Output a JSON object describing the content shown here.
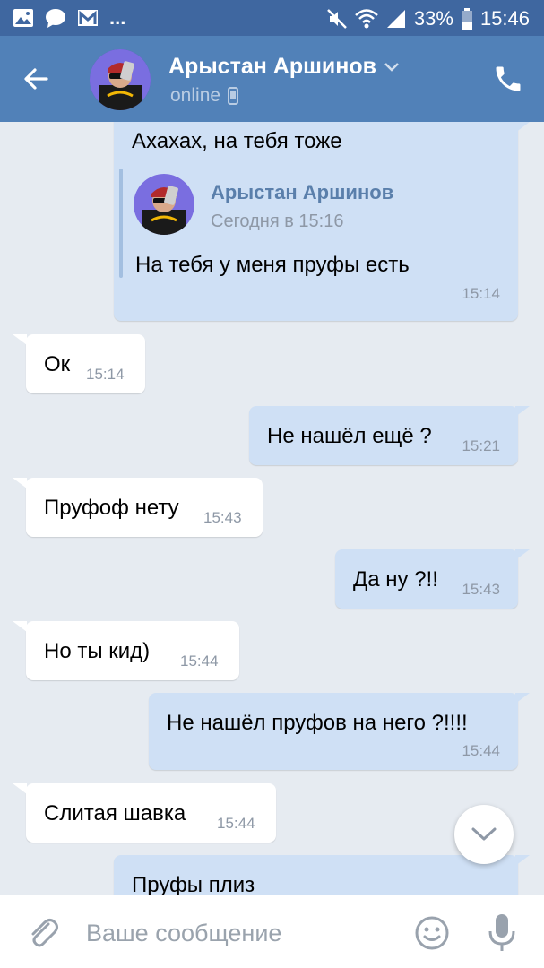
{
  "status_bar": {
    "battery": "33%",
    "time": "15:46",
    "left_icons": [
      "gallery-icon",
      "message-icon",
      "gmail-icon"
    ],
    "right_icons": [
      "mute-icon",
      "wifi-icon",
      "signal-icon",
      "battery-icon"
    ]
  },
  "header": {
    "contact_name": "Арыстан Аршинов",
    "status": "online",
    "status_device": "mobile-icon"
  },
  "messages": [
    {
      "direction": "out",
      "text": "Ахахах, на тебя тоже",
      "time": "15:14",
      "forwarded": {
        "author": "Арыстан Аршинов",
        "date": "Сегодня в 15:16",
        "text": "На тебя у меня пруфы есть"
      }
    },
    {
      "direction": "in",
      "text": "Ок",
      "time": "15:14"
    },
    {
      "direction": "out",
      "text": "Не нашёл ещё ?",
      "time": "15:21"
    },
    {
      "direction": "in",
      "text": "Пруфоф нету",
      "time": "15:43"
    },
    {
      "direction": "out",
      "text": "Да ну ?!!",
      "time": "15:43"
    },
    {
      "direction": "in",
      "text": "Но ты кид)",
      "time": "15:44"
    },
    {
      "direction": "out",
      "text": "Не нашёл пруфов на него ?!!!!",
      "time": "15:44"
    },
    {
      "direction": "in",
      "text": "Слитая шавка",
      "time": "15:44"
    },
    {
      "direction": "out",
      "text": "Пруфы плиз",
      "time": ""
    }
  ],
  "composer": {
    "placeholder": "Ваше сообщение"
  },
  "colors": {
    "status_bar": "#3f67a0",
    "header": "#5181b8",
    "background": "#e6ebf1",
    "outgoing_bubble": "#cfe0f5",
    "incoming_bubble": "#ffffff",
    "link_name": "#5a7fab"
  }
}
